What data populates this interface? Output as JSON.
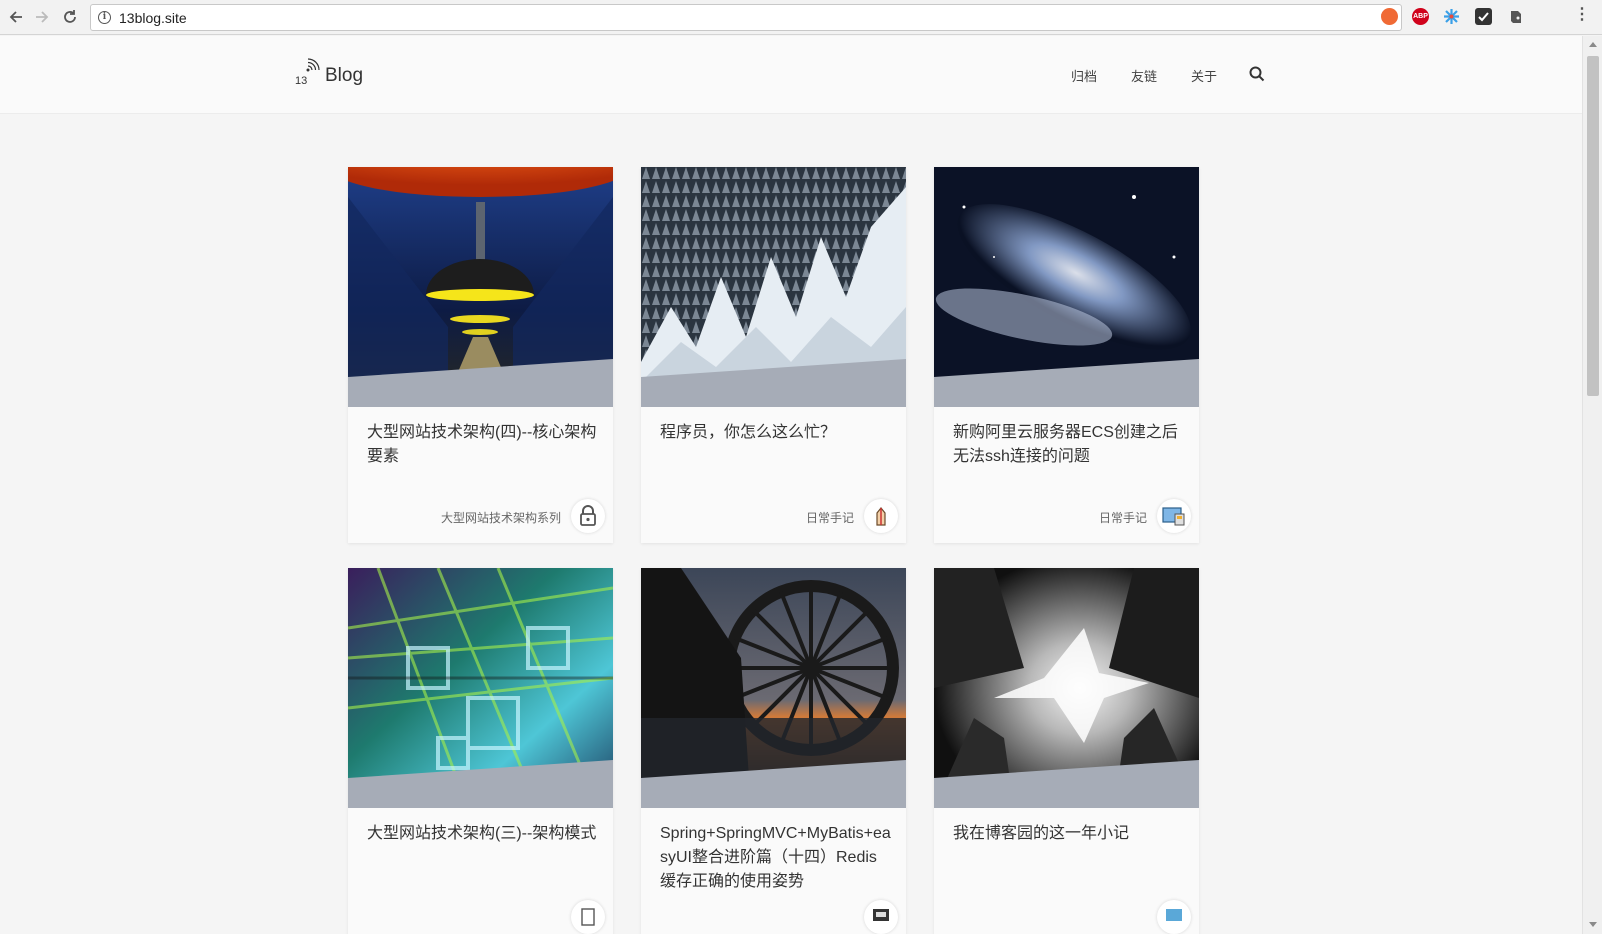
{
  "browser": {
    "url": "13blog.site",
    "back_icon": "arrow-left-icon",
    "forward_icon": "arrow-right-icon",
    "reload_icon": "reload-icon",
    "extensions": [
      {
        "name": "extension-orange-icon",
        "color": "#f06a35",
        "label": ""
      },
      {
        "name": "adblock-plus-icon",
        "color": "#d0021b",
        "label": "ABP"
      },
      {
        "name": "extension-pinwheel-icon",
        "color": "#3aa0e8",
        "label": ""
      },
      {
        "name": "extension-check-icon",
        "color": "#333333",
        "label": ""
      },
      {
        "name": "evernote-icon",
        "color": "#444444",
        "label": ""
      }
    ]
  },
  "site": {
    "logo_number": "13",
    "logo_text": "Blog",
    "nav": [
      {
        "label": "归档"
      },
      {
        "label": "友链"
      },
      {
        "label": "关于"
      }
    ],
    "search_icon": "search-icon"
  },
  "posts": [
    {
      "title": "大型网站技术架构(四)--核心架构要素",
      "category": "大型网站技术架构系列",
      "avatar_icon": "lock-icon",
      "image": "subway-lamp"
    },
    {
      "title": "程序员，你怎么这么忙？",
      "category": "日常手记",
      "avatar_icon": "pen-hand-icon",
      "image": "snowy-forest"
    },
    {
      "title": "新购阿里云服务器ECS创建之后无法ssh连接的问题",
      "category": "日常手记",
      "avatar_icon": "screen-icon",
      "image": "galaxy"
    },
    {
      "title": "大型网站技术架构(三)--架构模式",
      "category": "",
      "avatar_icon": "doc-icon",
      "image": "abstract-city"
    },
    {
      "title": "Spring+SpringMVC+MyBatis+easyUI整合进阶篇（十四）Redis缓存正确的使用姿势",
      "category": "",
      "avatar_icon": "printer-icon",
      "image": "waterwheel"
    },
    {
      "title": "我在博客园的这一年小记",
      "category": "",
      "avatar_icon": "monitor-icon",
      "image": "bat-city"
    }
  ]
}
